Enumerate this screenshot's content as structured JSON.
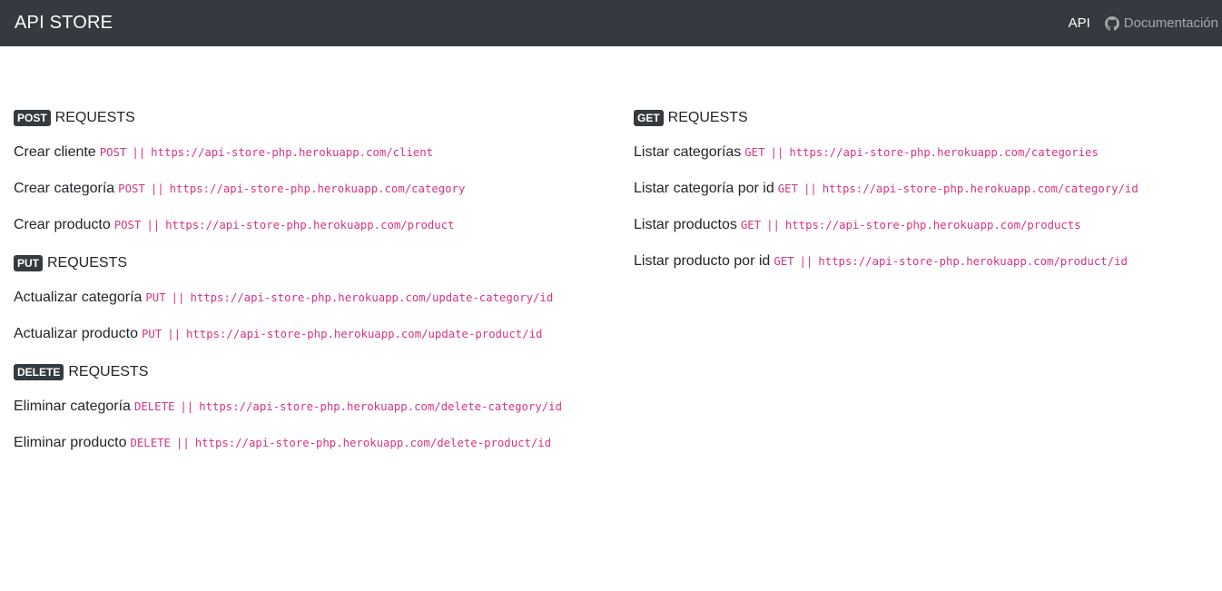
{
  "navbar": {
    "brand": "API STORE",
    "link_api": "API",
    "link_docs": "Documentación",
    "docs_icon": "github-icon"
  },
  "separator": "||",
  "left": {
    "post": {
      "badge": "POST",
      "title": "REQUESTS",
      "items": [
        {
          "label": "Crear cliente",
          "method": "POST",
          "url": "https://api-store-php.herokuapp.com/client"
        },
        {
          "label": "Crear categoría",
          "method": "POST",
          "url": "https://api-store-php.herokuapp.com/category"
        },
        {
          "label": "Crear producto",
          "method": "POST",
          "url": "https://api-store-php.herokuapp.com/product"
        }
      ]
    },
    "put": {
      "badge": "PUT",
      "title": "REQUESTS",
      "items": [
        {
          "label": "Actualizar categoría",
          "method": "PUT",
          "url": "https://api-store-php.herokuapp.com/update-category/id"
        },
        {
          "label": "Actualizar producto",
          "method": "PUT",
          "url": "https://api-store-php.herokuapp.com/update-product/id"
        }
      ]
    },
    "delete": {
      "badge": "DELETE",
      "title": "REQUESTS",
      "items": [
        {
          "label": "Eliminar categoría",
          "method": "DELETE",
          "url": "https://api-store-php.herokuapp.com/delete-category/id"
        },
        {
          "label": "Eliminar producto",
          "method": "DELETE",
          "url": "https://api-store-php.herokuapp.com/delete-product/id"
        }
      ]
    }
  },
  "right": {
    "get": {
      "badge": "GET",
      "title": "REQUESTS",
      "items": [
        {
          "label": "Listar categorías",
          "method": "GET",
          "url": "https://api-store-php.herokuapp.com/categories"
        },
        {
          "label": "Listar categoría por id",
          "method": "GET",
          "url": "https://api-store-php.herokuapp.com/category/id"
        },
        {
          "label": "Listar productos",
          "method": "GET",
          "url": "https://api-store-php.herokuapp.com/products"
        },
        {
          "label": "Listar producto por id",
          "method": "GET",
          "url": "https://api-store-php.herokuapp.com/product/id"
        }
      ]
    }
  },
  "colors": {
    "navbar_bg": "#343a40",
    "code_pink": "#d63384",
    "badge_bg": "#343a40"
  }
}
